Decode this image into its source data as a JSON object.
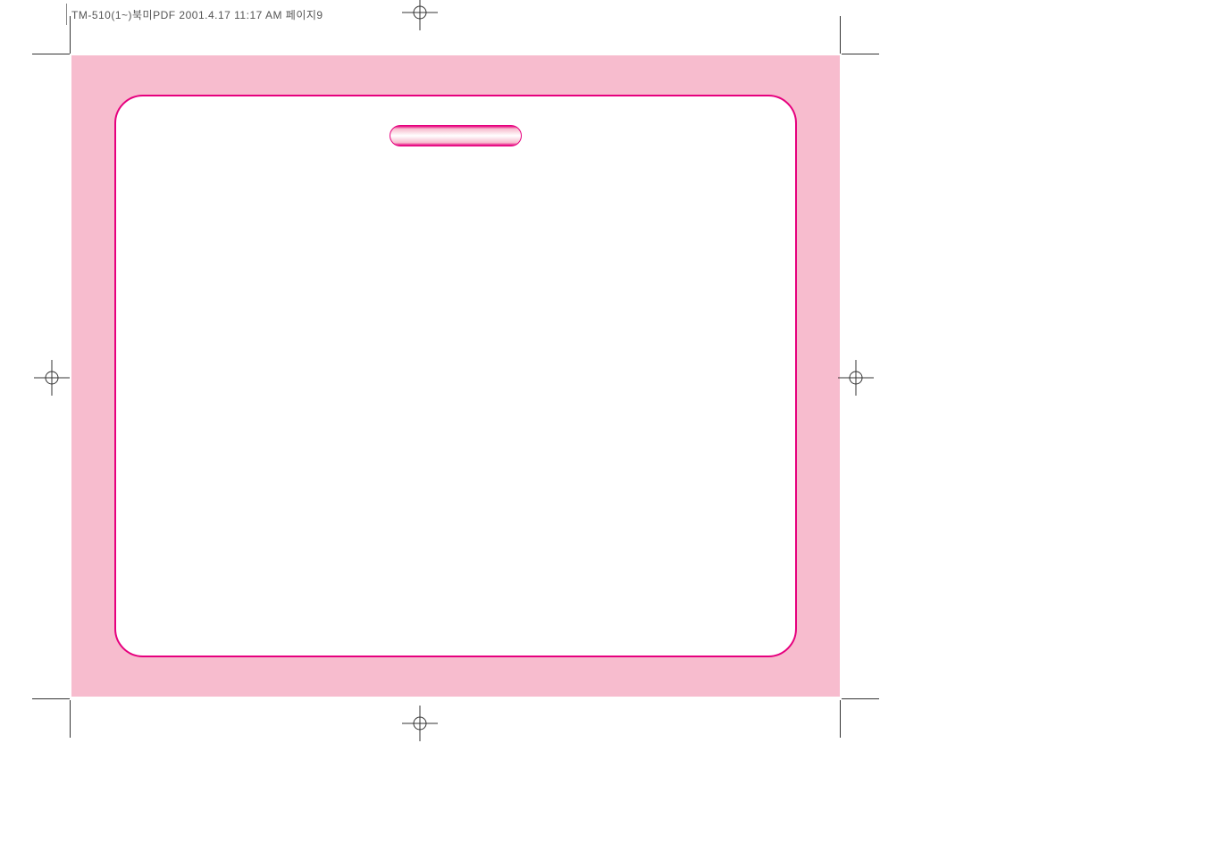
{
  "header": {
    "slug": "TM-510(1~)북미PDF 2001.4.17 11:17 AM 페이지9"
  },
  "colors": {
    "frame_bg": "#f7bcce",
    "border": "#e6007e",
    "page_bg": "#ffffff"
  }
}
